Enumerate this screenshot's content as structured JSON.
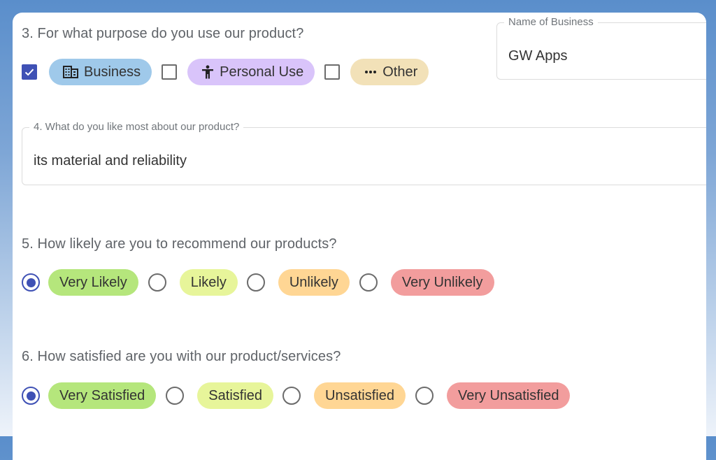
{
  "colors": {
    "accent": "#3f51b5",
    "pill_business": "#9fc9ea",
    "pill_personal": "#d9c4fa",
    "pill_other": "#f2e1b8",
    "pill_very_positive": "#b5e67c",
    "pill_positive": "#e7f59a",
    "pill_negative": "#ffd694",
    "pill_very_negative": "#f29d9d"
  },
  "q3": {
    "title": "3. For what purpose do you use our product?",
    "options": [
      {
        "label": "Business",
        "icon": "building-icon",
        "checked": true
      },
      {
        "label": "Personal Use",
        "icon": "person-icon",
        "checked": false
      },
      {
        "label": "Other",
        "icon": "more-horizontal-icon",
        "checked": false
      }
    ]
  },
  "business_name": {
    "label": "Name of Business",
    "value": "GW Apps"
  },
  "q4": {
    "label": "4. What do you like most about our product?",
    "value": "its material and reliability"
  },
  "q5": {
    "title": "5. How likely are you to recommend our products?",
    "selected": "Very Likely",
    "options": [
      {
        "label": "Very Likely"
      },
      {
        "label": "Likely"
      },
      {
        "label": "Unlikely"
      },
      {
        "label": "Very Unlikely"
      }
    ]
  },
  "q6": {
    "title": "6. How satisfied are you with our product/services?",
    "selected": "Very Satisfied",
    "options": [
      {
        "label": "Very Satisfied"
      },
      {
        "label": "Satisfied"
      },
      {
        "label": "Unsatisfied"
      },
      {
        "label": "Very Unsatisfied"
      }
    ]
  }
}
